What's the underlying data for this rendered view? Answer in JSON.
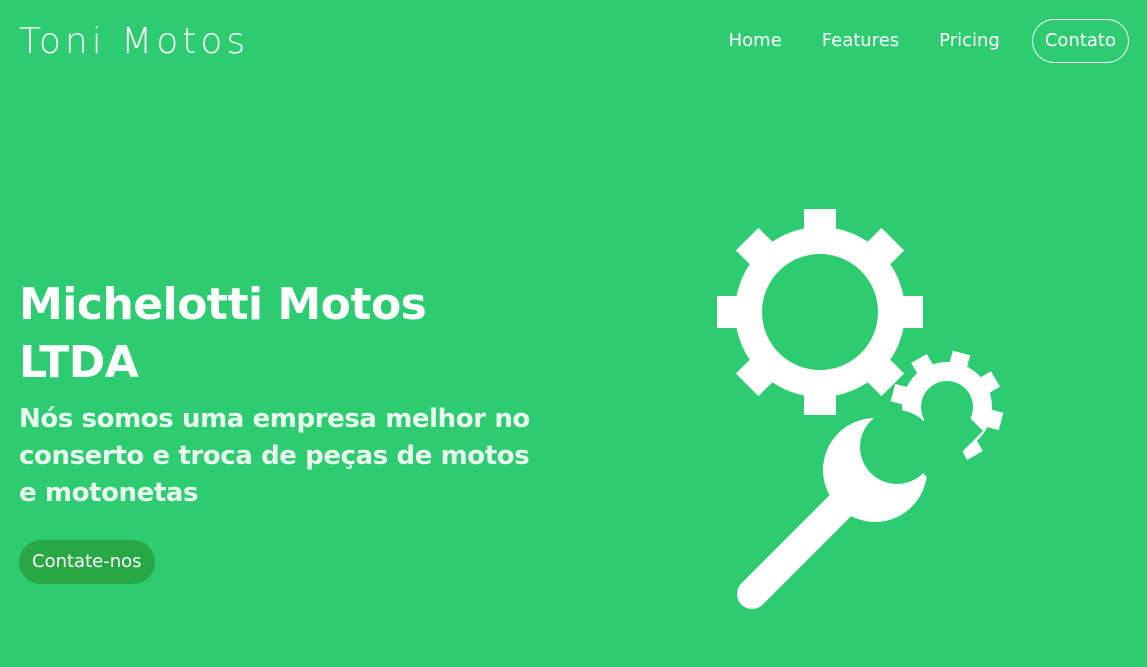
{
  "brand": "Toni Motos",
  "nav": {
    "items": [
      "Home",
      "Features",
      "Pricing"
    ],
    "cta": "Contato"
  },
  "hero": {
    "title": "Michelotti Motos LTDA",
    "subtitle": "Nós somos uma empresa melhor no conserto e troca de peças de motos e motonetas",
    "button": "Contate-nos",
    "illustration_icon": "gears-wrench-icon"
  },
  "colors": {
    "background": "#2ecc71",
    "text": "#ffffff",
    "button": "#28a745"
  }
}
